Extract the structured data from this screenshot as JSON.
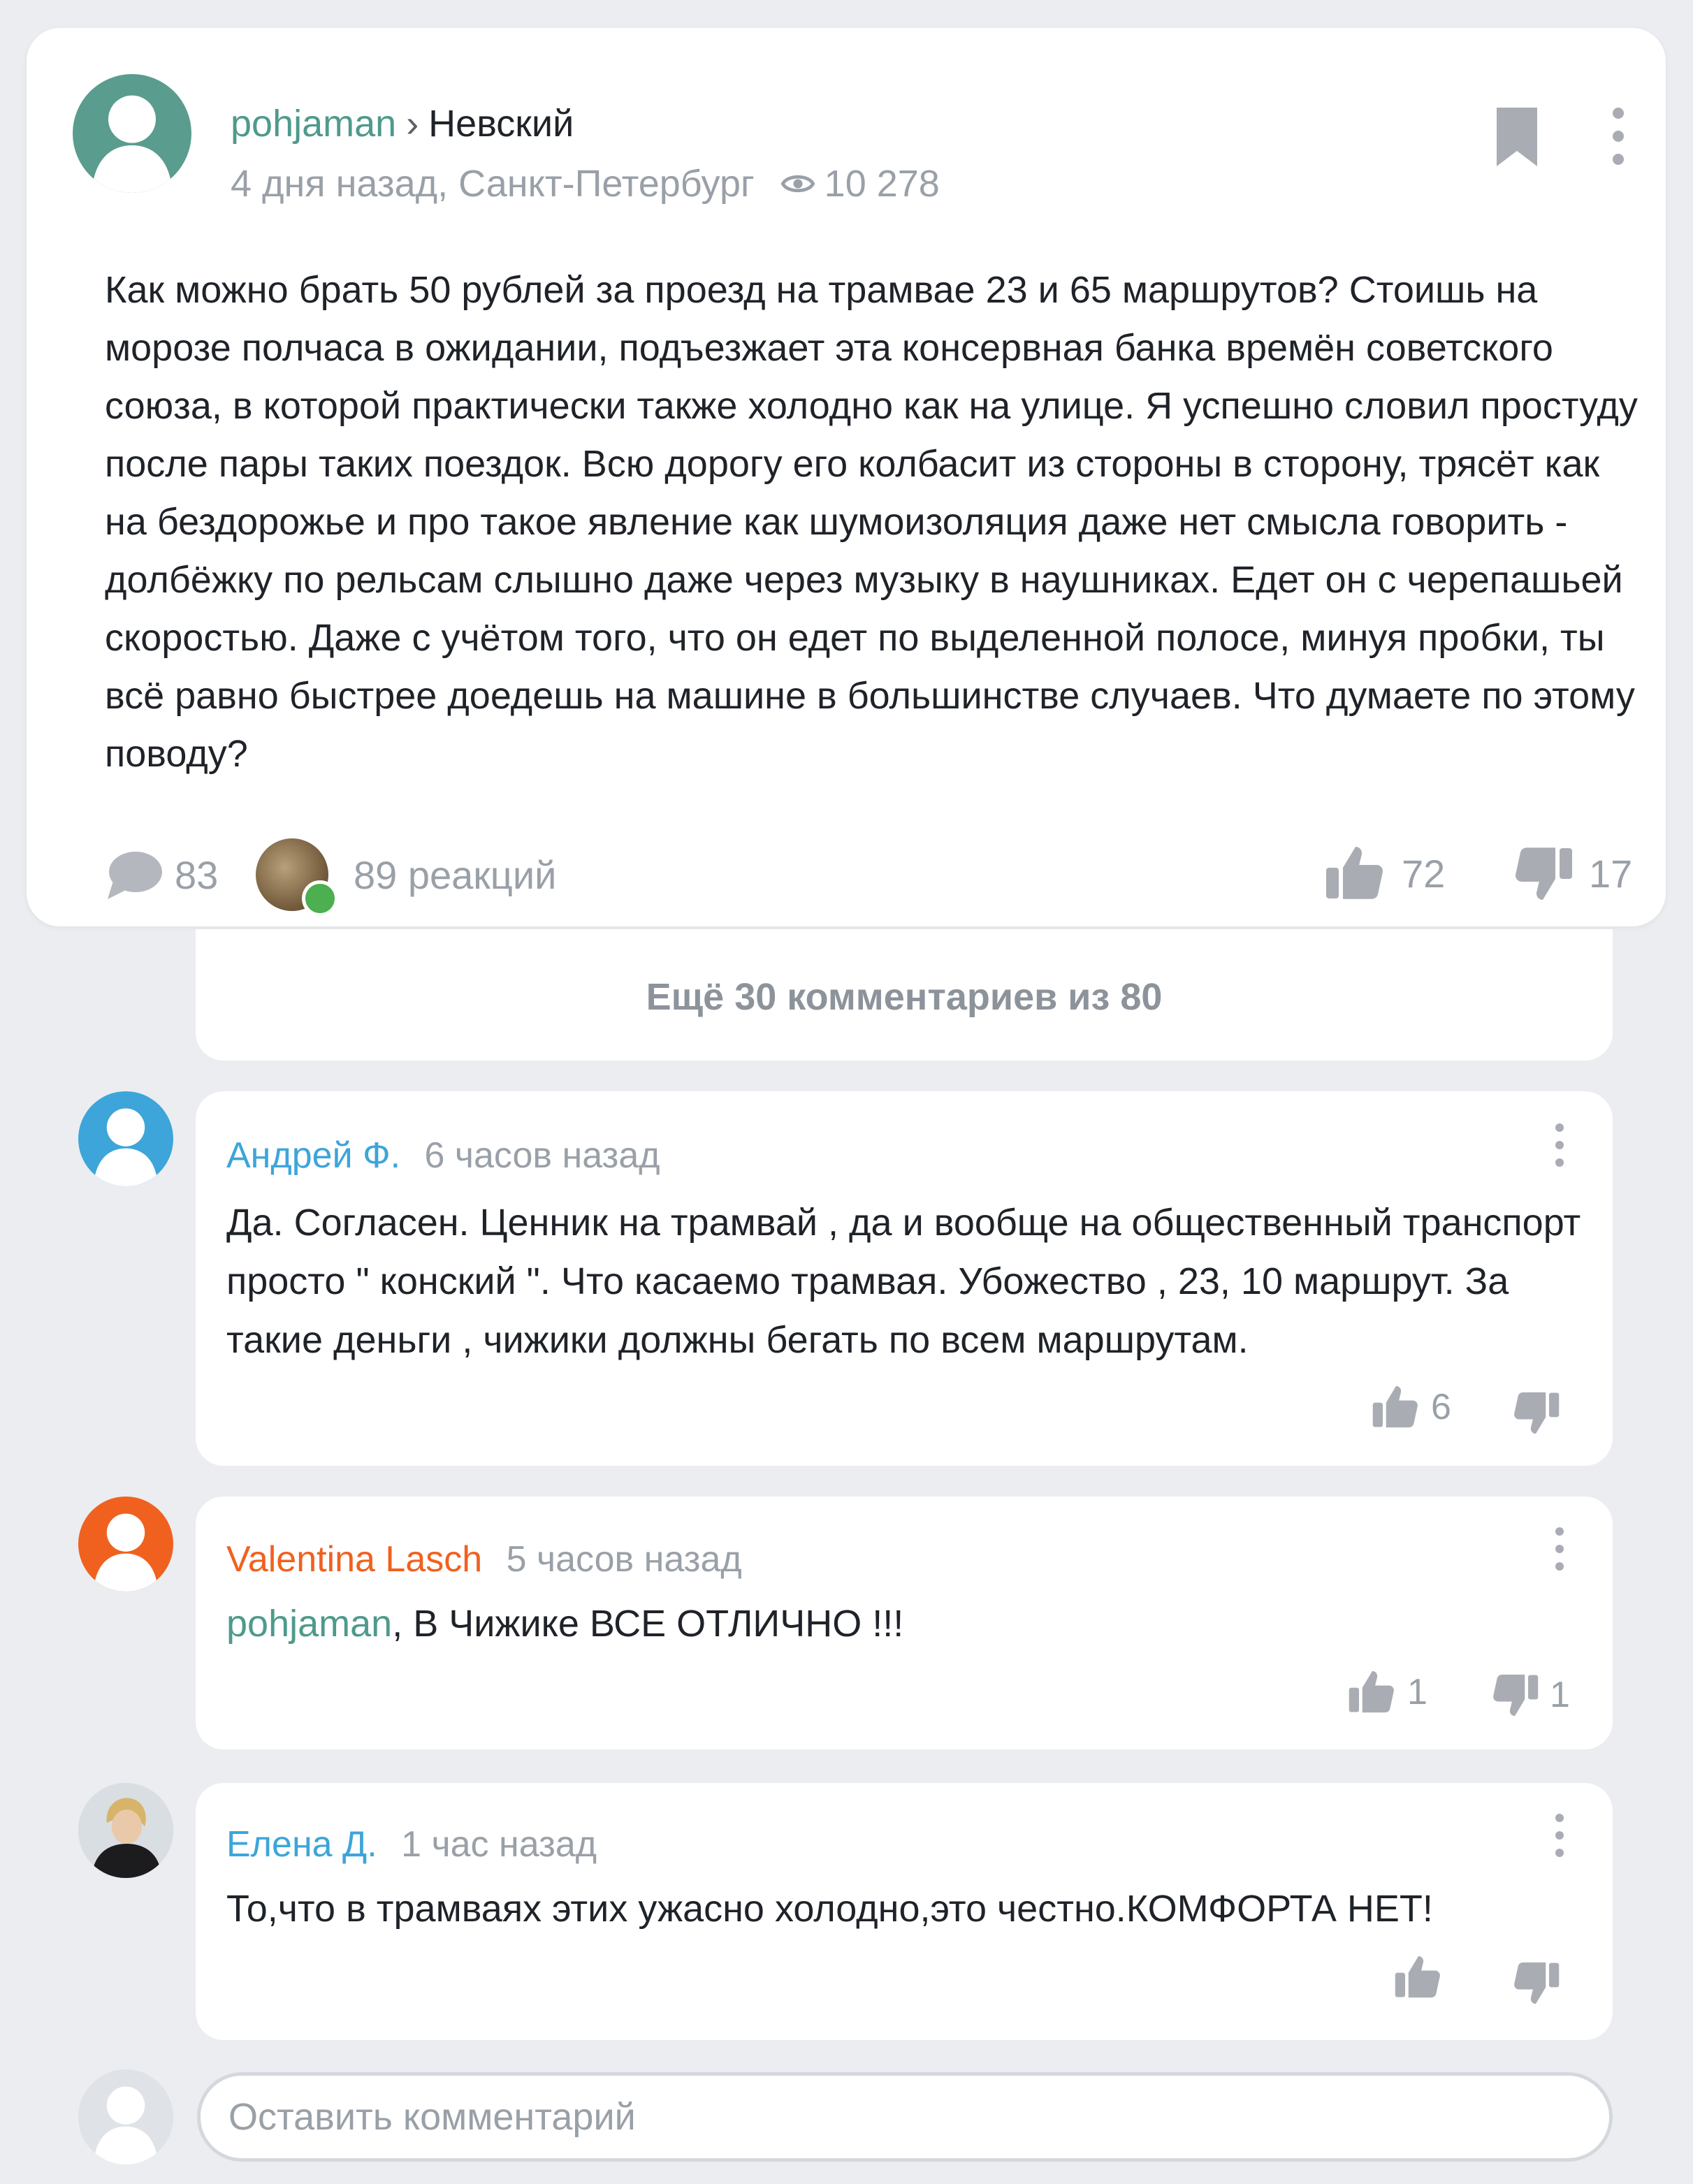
{
  "post": {
    "author": "pohjaman",
    "breadcrumb_separator": "›",
    "channel": "Невский",
    "meta": "4 дня назад, Санкт-Петербург",
    "views": "10 278",
    "text": "Как можно брать 50 рублей за проезд на трамвае 23 и 65 маршрутов? Стоишь на морозе полчаса в ожидании, подъезжает эта консервная банка времён советского союза, в которой практически также холодно как на улице. Я успешно словил простуду после пары таких поездок. Всю дорогу его колбасит из стороны в сторону, трясёт как на бездорожье и про такое явление как шумоизоляция даже нет смысла говорить - долбёжку по рельсам слышно даже через музыку в наушниках. Едет он с черепашьей скоростью. Даже с учётом того, что он едет по выделенной полосе, минуя пробки, ты всё равно быстрее доедешь на машине в большинстве случаев. Что думаете по этому поводу?",
    "comments_count": "83",
    "reactions": "89 реакций",
    "likes": "72",
    "dislikes": "17"
  },
  "more_comments": "Ещё 30 комментариев из 80",
  "comments": [
    {
      "author": "Андрей Ф.",
      "time": "6 часов назад",
      "reply_to": "",
      "text": "Да. Согласен. Ценник на трамвай , да и вообще на общественный транспорт просто \" конский \". Что касаемо трамвая. Убожество , 23, 10 маршрут. За такие деньги , чижики должны бегать по всем маршрутам.",
      "likes": "6",
      "dislikes": ""
    },
    {
      "author": "Valentina Lasch",
      "time": "5 часов назад",
      "reply_to": "pohjaman",
      "text": ", В Чижике ВСЕ ОТЛИЧНО !!!",
      "likes": "1",
      "dislikes": "1"
    },
    {
      "author": "Елена Д.",
      "time": "1 час назад",
      "reply_to": "",
      "text": "То,что в трамваях этих ужасно холодно,это честно.КОМФОРТА НЕТ!",
      "likes": "",
      "dislikes": ""
    }
  ],
  "composer": {
    "placeholder": "Оставить комментарий"
  },
  "colors": {
    "page_background": "#ebedf0",
    "post_author": "#4e9a8c",
    "comment_author_1": "#3da5d9",
    "comment_author_2": "#f0611f",
    "comment_author_3": "#3da5d9",
    "secondary_text": "#9aa0a8",
    "icon_gray": "#a9adb3",
    "online_badge": "#4caf50"
  },
  "icons": {
    "bookmark": "bookmark-icon",
    "more": "more-vertical-icon",
    "views": "eye-icon",
    "comments": "speech-bubble-icon",
    "like": "thumbs-up-icon",
    "dislike": "thumbs-down-icon"
  }
}
